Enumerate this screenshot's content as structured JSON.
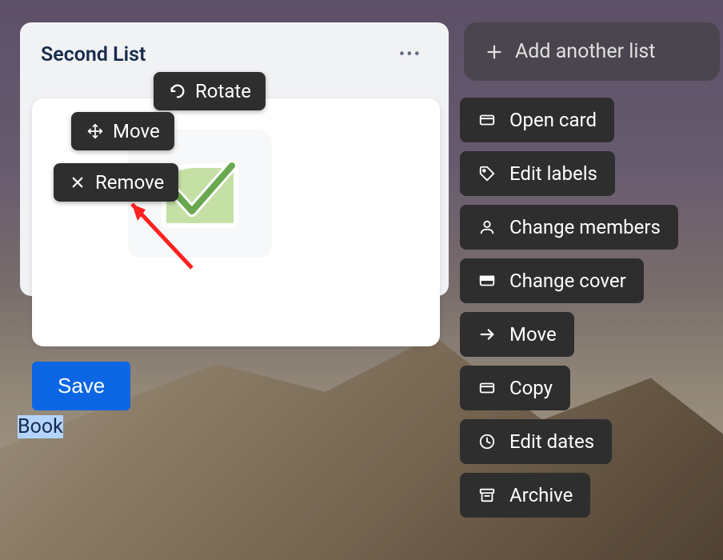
{
  "list": {
    "title": "Second List"
  },
  "card": {
    "text": "Book"
  },
  "sticker_actions": {
    "rotate": "Rotate",
    "move": "Move",
    "remove": "Remove"
  },
  "save_label": "Save",
  "add_list_label": "Add another list",
  "card_actions": [
    {
      "icon": "card-icon",
      "label": "Open card"
    },
    {
      "icon": "label-icon",
      "label": "Edit labels"
    },
    {
      "icon": "member-icon",
      "label": "Change members"
    },
    {
      "icon": "cover-icon",
      "label": "Change cover"
    },
    {
      "icon": "move-icon",
      "label": "Move"
    },
    {
      "icon": "copy-icon",
      "label": "Copy"
    },
    {
      "icon": "dates-icon",
      "label": "Edit dates"
    },
    {
      "icon": "archive-icon",
      "label": "Archive"
    }
  ]
}
